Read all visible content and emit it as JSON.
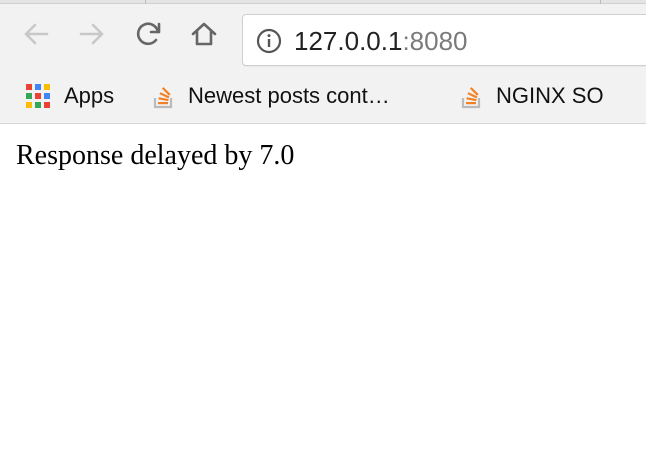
{
  "toolbar": {
    "back_icon": "arrow-left-icon",
    "forward_icon": "arrow-right-icon",
    "reload_icon": "reload-icon",
    "home_icon": "home-icon"
  },
  "omnibox": {
    "info_icon": "info-circle-icon",
    "url_host": "127.0.0.1",
    "url_port": ":8080"
  },
  "bookmarks": {
    "items": [
      {
        "icon": "apps-grid-icon",
        "label": "Apps"
      },
      {
        "icon": "stackoverflow-icon",
        "label": "Newest posts cont…"
      },
      {
        "icon": "stackoverflow-icon",
        "label": "NGINX SO"
      }
    ]
  },
  "page": {
    "body_text": "Response delayed by 7.0"
  },
  "colors": {
    "chrome_bg": "#f2f2f2",
    "icon_disabled": "#c8c8c8",
    "icon_active": "#666666",
    "stackoverflow_orange": "#f48024",
    "stackoverflow_gray": "#bcbbbb"
  }
}
